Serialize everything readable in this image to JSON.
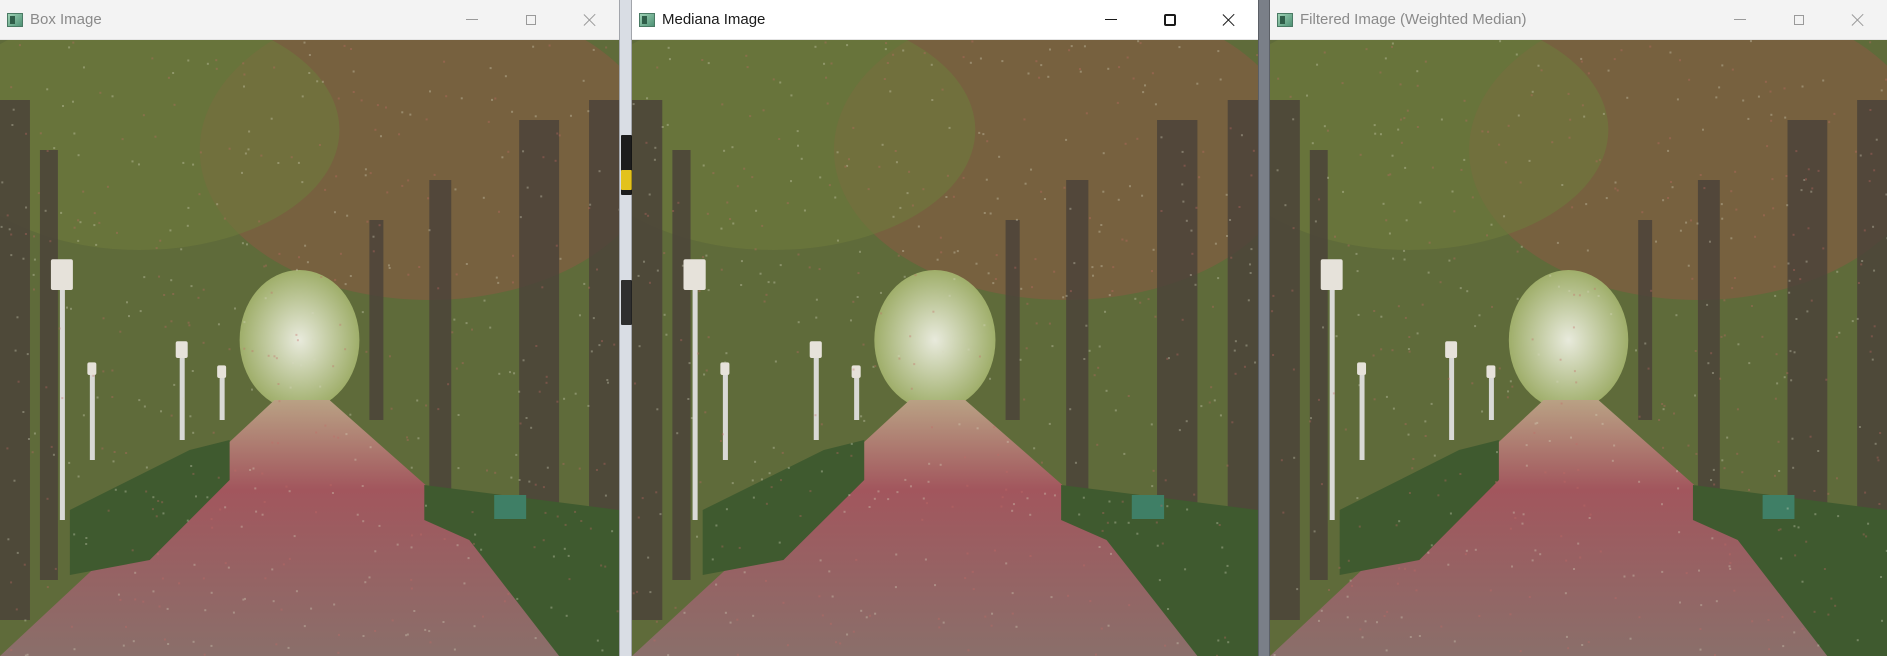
{
  "windows": [
    {
      "id": "box",
      "title": "Box Image",
      "active": false,
      "content": "park-avenue-photo"
    },
    {
      "id": "mediana",
      "title": "Mediana Image",
      "active": true,
      "content": "park-avenue-photo"
    },
    {
      "id": "weighted",
      "title": "Filtered Image (Weighted Median)",
      "active": false,
      "content": "park-avenue-photo"
    }
  ],
  "controls": {
    "minimize": "minimize-icon",
    "maximize": "maximize-icon",
    "close": "close-icon"
  },
  "colors": {
    "foliage": "#5f6b3a",
    "path": "#9c5058",
    "hedge": "#3f5a2f",
    "trunk": "#4b4339",
    "lamp": "#d9d9d6"
  }
}
